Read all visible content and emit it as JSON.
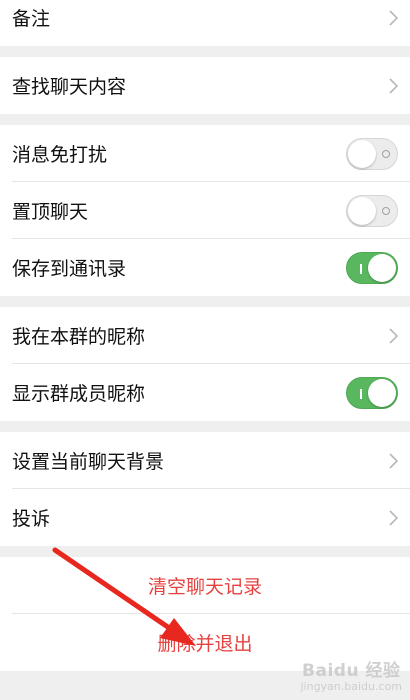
{
  "groups": [
    {
      "rows": [
        {
          "label": "备注",
          "control": "chevron"
        }
      ]
    },
    {
      "rows": [
        {
          "label": "查找聊天内容",
          "control": "chevron"
        }
      ]
    },
    {
      "rows": [
        {
          "label": "消息免打扰",
          "control": "toggle",
          "on": false
        },
        {
          "label": "置顶聊天",
          "control": "toggle",
          "on": false
        },
        {
          "label": "保存到通讯录",
          "control": "toggle",
          "on": true
        }
      ]
    },
    {
      "rows": [
        {
          "label": "我在本群的昵称",
          "control": "chevron"
        },
        {
          "label": "显示群成员昵称",
          "control": "toggle",
          "on": true
        }
      ]
    },
    {
      "rows": [
        {
          "label": "设置当前聊天背景",
          "control": "chevron"
        },
        {
          "label": "投诉",
          "control": "chevron"
        }
      ]
    }
  ],
  "actions": {
    "clear_history": "清空聊天记录",
    "delete_and_exit": "删除并退出"
  },
  "annotation": {
    "arrow_color": "#e8271f"
  },
  "watermark": {
    "brand": "Baidu 经验",
    "sub": "jingyan.baidu.com"
  },
  "colors": {
    "toggle_on": "#59b75f",
    "danger_text": "#e64340",
    "background": "#efefef"
  }
}
